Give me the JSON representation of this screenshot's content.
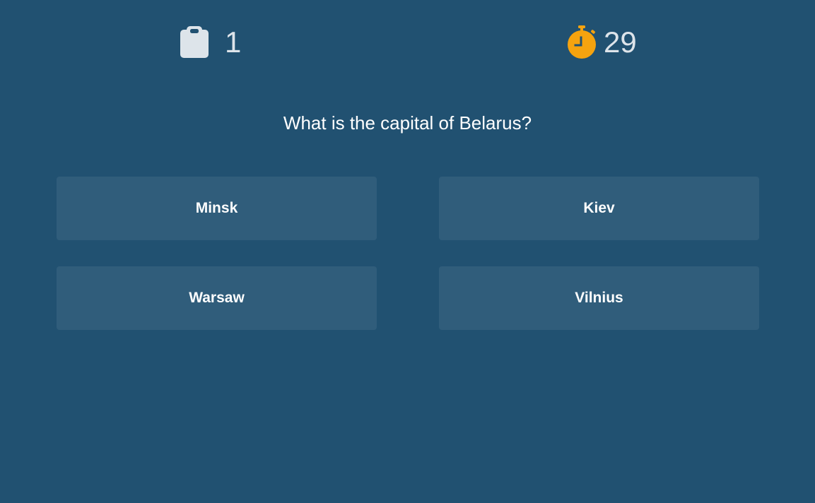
{
  "header": {
    "question_counter": {
      "icon": "clipboard-icon",
      "value": "1",
      "icon_color": "#dde4ea"
    },
    "timer": {
      "icon": "stopwatch-icon",
      "value": "29",
      "icon_color": "#f5a30f"
    }
  },
  "question": {
    "text": "What is the capital of Belarus?"
  },
  "answers": [
    {
      "label": "Minsk"
    },
    {
      "label": "Kiev"
    },
    {
      "label": "Warsaw"
    },
    {
      "label": "Vilnius"
    }
  ],
  "colors": {
    "background": "#215171",
    "answer_background": "#305d7b",
    "text": "#ffffff",
    "counter_text": "#dde4ea",
    "timer_accent": "#f5a30f"
  }
}
